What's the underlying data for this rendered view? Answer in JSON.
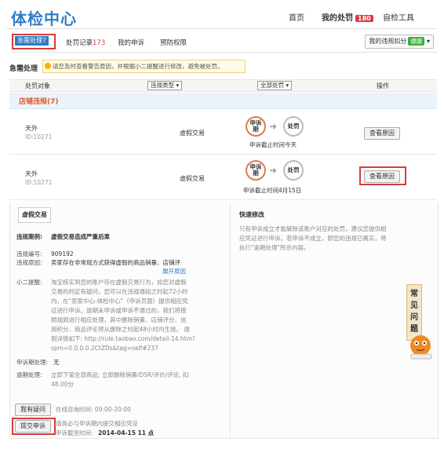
{
  "header": {
    "logo": "体检中心",
    "nav": [
      {
        "label": "首页"
      },
      {
        "label": "我的处罚",
        "badge": "180"
      },
      {
        "label": "自检工具"
      }
    ]
  },
  "tabs": {
    "active": "急需处理7",
    "items": [
      {
        "label": "处罚记录",
        "count": "173"
      },
      {
        "label": "我的申诉"
      },
      {
        "label": "预防权限"
      }
    ],
    "deduct_label": "我的违规扣分",
    "deduct_status": "健康"
  },
  "urgent": {
    "title": "急需处理",
    "tip": "请您及时查看警告原因，并根据小二提醒进行修改，避免被处罚。"
  },
  "table": {
    "headers": {
      "object": "处罚对象",
      "type_select": "违规类型",
      "penalty_select": "全部处罚",
      "action": "操作"
    },
    "section": "店铺违规(7)",
    "rows": [
      {
        "name": "天外",
        "id": "ID:10271",
        "type": "虚假交易",
        "step1": "申诉期",
        "step2": "处罚",
        "deadline": "申诉截止时间今天",
        "action": "查看原因"
      },
      {
        "name": "天外",
        "id": "ID:10271",
        "type": "虚假交易",
        "step1": "申诉期",
        "step2": "处罚",
        "deadline": "申诉截止时间4月15日",
        "action": "查看原因"
      }
    ]
  },
  "detail": {
    "tab": "虚假交易",
    "case_label": "违规案例:",
    "case_value": "虚假交易造成严重后果",
    "number_label": "违规编号:",
    "number_value": "909192",
    "reason_label": "违规原因:",
    "reason_value": "卖家存在非常规方式获得虚假的商品销量、店铺评",
    "expand": "展开原因",
    "reminder_label": "小二提醒:",
    "reminder_lines": [
      "淘宝核实到您的账户存在虚假交易行为，如您对虚假",
      "交易的判定有疑问，您可以在违规通知之时起72小时",
      "内，在\"卖家中心-体检中心\"（申诉页面）提供相应凭",
      "证进行申诉。逾期未申诉或申诉不通过的，我们将按",
      "照规则进行相应处理，其中删除销量、店铺评分、信",
      "用积分、商品评论将从删除之时起48小时内生效。 规",
      "则详情如下: http://rule.taobao.com/detail-14.htm?",
      "spm=0.0.0.0.2CtZDs&tag=self#237"
    ],
    "appeal_period_label": "申诉期处理:",
    "appeal_period_value": "无",
    "overdue_label": "逾期处理:",
    "overdue_lines": [
      "立即下架全部商品; 立即删除销量/DSR/评价/评论, 扣",
      "48.00分"
    ],
    "question_btn": "我有疑问",
    "online_time": "在线咨询时间: 09:00-20:00",
    "submit_btn": "提交申诉",
    "submit_note": "请务必与申诉期内提交相应凭证",
    "submit_deadline_label": "申诉截至时间:",
    "submit_deadline_value": "2014-04-15 11 点",
    "fix_title": "快速修改",
    "fix_lines": [
      "只有申诉成立才能解除该账户对应的处罚，建议您提供相",
      "应凭证进行申诉。若申诉不成立，即您的违规已属实，将",
      "执行\"逾期处理\"所示内容。"
    ]
  },
  "side": {
    "faq": "常见问题"
  }
}
